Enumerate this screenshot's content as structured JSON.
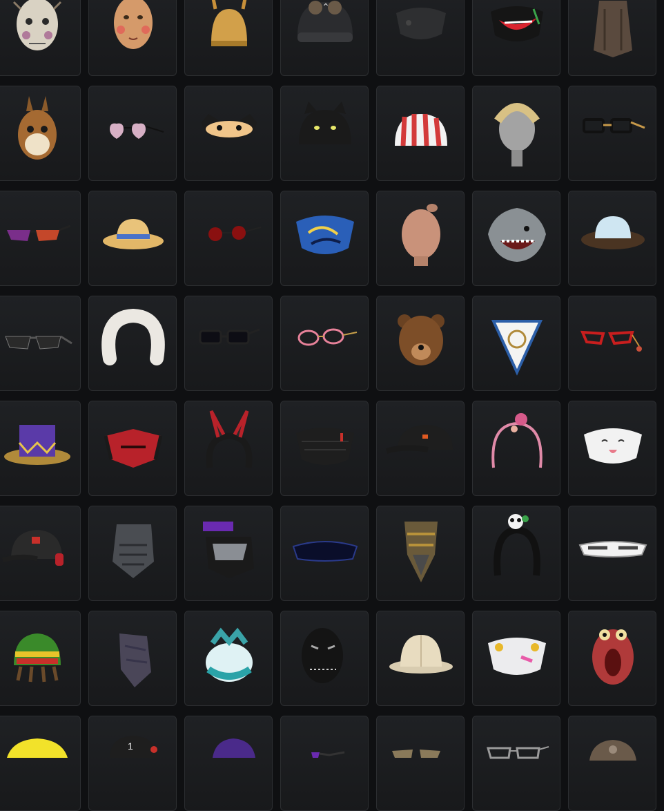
{
  "inventory": {
    "items": [
      {
        "name": "scarecrow-mask-icon"
      },
      {
        "name": "wooden-doll-mask-icon"
      },
      {
        "name": "viking-helmet-icon"
      },
      {
        "name": "aviator-beanie-icon"
      },
      {
        "name": "black-face-mask-icon"
      },
      {
        "name": "joker-grin-mask-icon"
      },
      {
        "name": "tattered-hood-icon"
      },
      {
        "name": "chipmunk-mask-icon"
      },
      {
        "name": "heart-sunglasses-icon"
      },
      {
        "name": "cat-eye-mask-icon"
      },
      {
        "name": "black-cat-beanie-icon"
      },
      {
        "name": "striped-bucket-hat-icon"
      },
      {
        "name": "braided-hair-icon"
      },
      {
        "name": "black-glasses-icon"
      },
      {
        "name": "gradient-sunglasses-icon"
      },
      {
        "name": "straw-sun-hat-icon"
      },
      {
        "name": "round-red-glasses-icon"
      },
      {
        "name": "graffiti-face-mask-icon"
      },
      {
        "name": "bald-head-icon"
      },
      {
        "name": "shark-mask-icon"
      },
      {
        "name": "floppy-hat-icon"
      },
      {
        "name": "dark-sunglasses-icon"
      },
      {
        "name": "fur-headband-icon"
      },
      {
        "name": "black-rim-glasses-icon"
      },
      {
        "name": "pink-glasses-icon"
      },
      {
        "name": "bear-mask-icon"
      },
      {
        "name": "nautical-bandana-icon"
      },
      {
        "name": "red-chain-glasses-icon"
      },
      {
        "name": "purple-top-hat-icon"
      },
      {
        "name": "red-tactical-mask-icon"
      },
      {
        "name": "bunny-ear-headband-icon"
      },
      {
        "name": "black-sport-mask-icon"
      },
      {
        "name": "black-cap-icon"
      },
      {
        "name": "rose-headband-icon"
      },
      {
        "name": "cute-face-mask-icon"
      },
      {
        "name": "headset-cap-icon"
      },
      {
        "name": "metal-face-guard-icon"
      },
      {
        "name": "visor-face-guard-icon"
      },
      {
        "name": "shield-sunglasses-icon"
      },
      {
        "name": "camo-scarf-icon"
      },
      {
        "name": "panda-headband-icon"
      },
      {
        "name": "white-sport-glasses-icon"
      },
      {
        "name": "rasta-dreadlock-hat-icon"
      },
      {
        "name": "purple-scarf-icon"
      },
      {
        "name": "teal-fluffy-hat-icon"
      },
      {
        "name": "stitched-black-mask-icon"
      },
      {
        "name": "pith-helmet-icon"
      },
      {
        "name": "cyber-face-mask-icon"
      },
      {
        "name": "red-creature-mask-icon"
      },
      {
        "name": "yellow-cap-icon"
      },
      {
        "name": "number-cap-icon"
      },
      {
        "name": "purple-cap-icon"
      },
      {
        "name": "purple-glasses-icon"
      },
      {
        "name": "tan-glasses-icon"
      },
      {
        "name": "silver-glasses-icon"
      },
      {
        "name": "brown-helmet-icon"
      }
    ]
  },
  "scroll": {
    "up_icon": "chevron-up-icon"
  }
}
